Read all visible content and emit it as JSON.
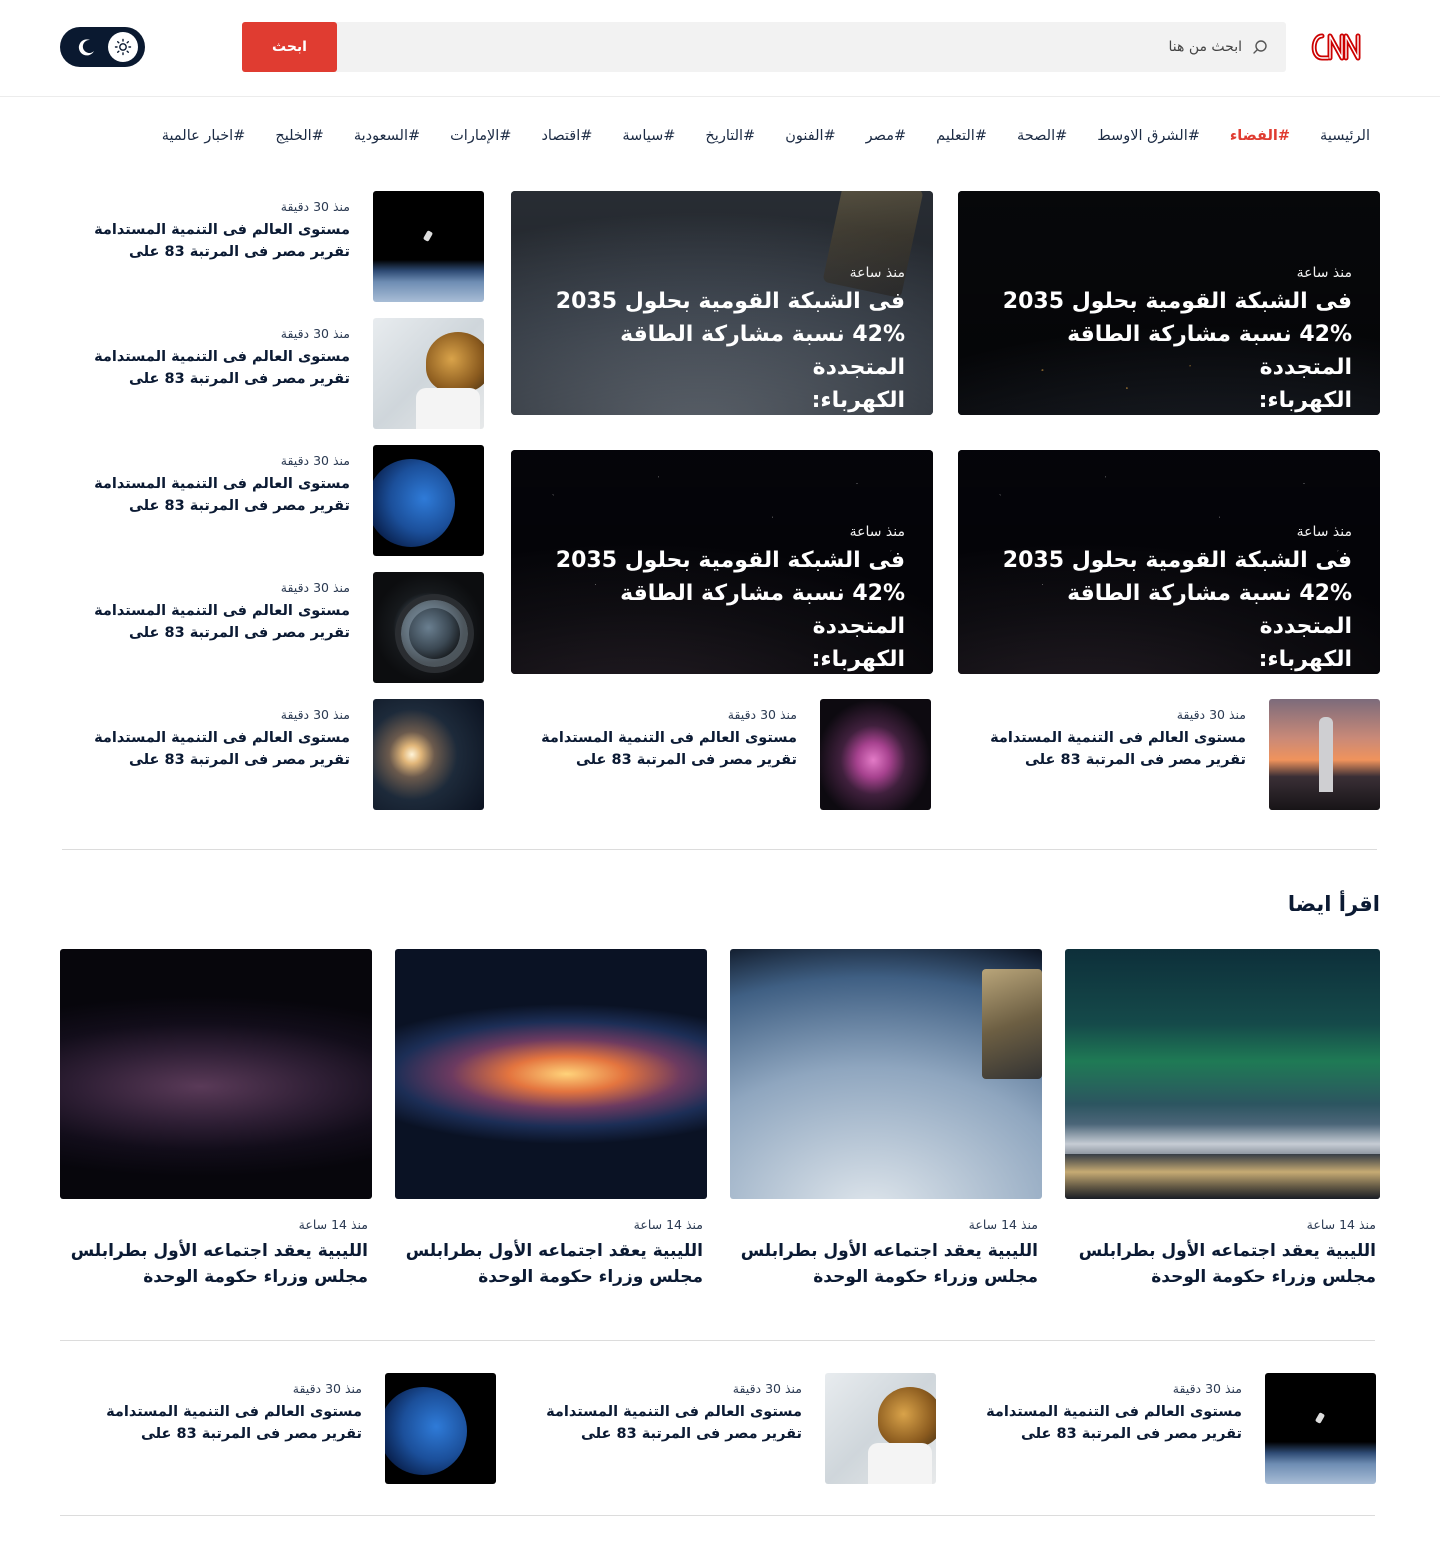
{
  "header": {
    "search_button": "ابحث",
    "search_placeholder": "ابحث من هنا",
    "logo_icon": "cnn-logo",
    "accent_color": "#e03c31",
    "toggle_color": "#0a1930"
  },
  "nav": {
    "items": [
      {
        "label": "الرئيسية",
        "active": false
      },
      {
        "label": "#الفضاء",
        "active": true
      },
      {
        "label": "#الشرق الاوسط",
        "active": false
      },
      {
        "label": "#الصحة",
        "active": false
      },
      {
        "label": "#التعليم",
        "active": false
      },
      {
        "label": "#مصر",
        "active": false
      },
      {
        "label": "#الفنون",
        "active": false
      },
      {
        "label": "#التاريخ",
        "active": false
      },
      {
        "label": "#سياسة",
        "active": false
      },
      {
        "label": "#اقتصاد",
        "active": false
      },
      {
        "label": "#الإمارات",
        "active": false
      },
      {
        "label": "#السعودية",
        "active": false
      },
      {
        "label": "#الخليج",
        "active": false
      },
      {
        "label": "#اخبار عالمية",
        "active": false
      }
    ]
  },
  "hero": [
    {
      "time": "منذ ساعة",
      "title_lines": [
        "فى الشبكة القومية بحلول 2035",
        "42% نسبة مشاركة الطاقة المتجددة",
        "الكهرباء:"
      ]
    },
    {
      "time": "منذ ساعة",
      "title_lines": [
        "فى الشبكة القومية بحلول 2035",
        "42% نسبة مشاركة الطاقة المتجددة",
        "الكهرباء:"
      ]
    },
    {
      "time": "منذ ساعة",
      "title_lines": [
        "فى الشبكة القومية بحلول 2035",
        "42% نسبة مشاركة الطاقة المتجددة",
        "الكهرباء:"
      ]
    },
    {
      "time": "منذ ساعة",
      "title_lines": [
        "فى الشبكة القومية بحلول 2035",
        "42% نسبة مشاركة الطاقة المتجددة",
        "الكهرباء:"
      ]
    }
  ],
  "side_list": [
    {
      "time": "منذ 30 دقيقة",
      "line1": "مستوى العالم فى التنمية المستدامة",
      "line2": "تقرير  مصر فى المرتبة 83 على"
    },
    {
      "time": "منذ 30 دقيقة",
      "line1": "مستوى العالم فى التنمية المستدامة",
      "line2": "تقرير  مصر فى المرتبة 83 على"
    },
    {
      "time": "منذ 30 دقيقة",
      "line1": "مستوى العالم فى التنمية المستدامة",
      "line2": "تقرير  مصر فى المرتبة 83 على"
    },
    {
      "time": "منذ 30 دقيقة",
      "line1": "مستوى العالم فى التنمية المستدامة",
      "line2": "تقرير  مصر فى المرتبة 83 على"
    },
    {
      "time": "منذ 30 دقيقة",
      "line1": "مستوى العالم فى التنمية المستدامة",
      "line2": "تقرير  مصر فى المرتبة 83 على"
    }
  ],
  "mid_list": [
    {
      "time": "منذ 30 دقيقة",
      "line1": "مستوى العالم فى التنمية المستدامة",
      "line2": "تقرير  مصر فى المرتبة 83 على"
    },
    {
      "time": "منذ 30 دقيقة",
      "line1": "مستوى العالم فى التنمية المستدامة",
      "line2": "تقرير  مصر فى المرتبة 83 على"
    }
  ],
  "read_also": {
    "title": "اقرأ ايضا",
    "cards": [
      {
        "time": "منذ 14 ساعة",
        "line1": "الليبية يعقد اجتماعه الأول بطرابلس",
        "line2": "مجلس وزراء حكومة الوحدة"
      },
      {
        "time": "منذ 14 ساعة",
        "line1": "الليبية يعقد اجتماعه الأول بطرابلس",
        "line2": "مجلس وزراء حكومة الوحدة"
      },
      {
        "time": "منذ 14 ساعة",
        "line1": "الليبية يعقد اجتماعه الأول بطرابلس",
        "line2": "مجلس وزراء حكومة الوحدة"
      },
      {
        "time": "منذ 14 ساعة",
        "line1": "الليبية يعقد اجتماعه الأول بطرابلس",
        "line2": "مجلس وزراء حكومة الوحدة"
      }
    ]
  },
  "bottom_list": [
    {
      "time": "منذ 30 دقيقة",
      "line1": "مستوى العالم فى التنمية المستدامة",
      "line2": "تقرير  مصر فى المرتبة 83 على"
    },
    {
      "time": "منذ 30 دقيقة",
      "line1": "مستوى العالم فى التنمية المستدامة",
      "line2": "تقرير  مصر فى المرتبة 83 على"
    },
    {
      "time": "منذ 30 دقيقة",
      "line1": "مستوى العالم فى التنمية المستدامة",
      "line2": "تقرير  مصر فى المرتبة 83 على"
    }
  ]
}
